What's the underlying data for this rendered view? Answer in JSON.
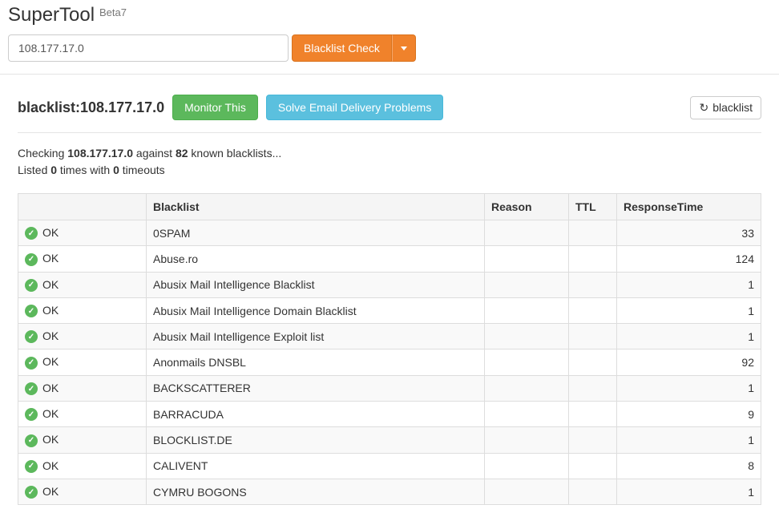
{
  "header": {
    "title": "SuperTool",
    "beta": "Beta7",
    "input_value": "108.177.17.0",
    "check_button": "Blacklist Check"
  },
  "result": {
    "title": "blacklist:108.177.17.0",
    "monitor_button": "Monitor This",
    "solve_button": "Solve Email Delivery Problems",
    "refresh_label": "blacklist",
    "checking_prefix": "Checking ",
    "checking_ip": "108.177.17.0",
    "checking_mid": " against ",
    "blacklist_count": "82",
    "checking_suffix": " known blacklists...",
    "listed_prefix": "Listed ",
    "listed_count": "0",
    "listed_mid": " times with ",
    "timeout_count": "0",
    "listed_suffix": " timeouts"
  },
  "table": {
    "headers": {
      "status": "",
      "blacklist": "Blacklist",
      "reason": "Reason",
      "ttl": "TTL",
      "response_time": "ResponseTime"
    },
    "rows": [
      {
        "status": "OK",
        "blacklist": "0SPAM",
        "reason": "",
        "ttl": "",
        "response_time": "33"
      },
      {
        "status": "OK",
        "blacklist": "Abuse.ro",
        "reason": "",
        "ttl": "",
        "response_time": "124"
      },
      {
        "status": "OK",
        "blacklist": "Abusix Mail Intelligence Blacklist",
        "reason": "",
        "ttl": "",
        "response_time": "1"
      },
      {
        "status": "OK",
        "blacklist": "Abusix Mail Intelligence Domain Blacklist",
        "reason": "",
        "ttl": "",
        "response_time": "1"
      },
      {
        "status": "OK",
        "blacklist": "Abusix Mail Intelligence Exploit list",
        "reason": "",
        "ttl": "",
        "response_time": "1"
      },
      {
        "status": "OK",
        "blacklist": "Anonmails DNSBL",
        "reason": "",
        "ttl": "",
        "response_time": "92"
      },
      {
        "status": "OK",
        "blacklist": "BACKSCATTERER",
        "reason": "",
        "ttl": "",
        "response_time": "1"
      },
      {
        "status": "OK",
        "blacklist": "BARRACUDA",
        "reason": "",
        "ttl": "",
        "response_time": "9"
      },
      {
        "status": "OK",
        "blacklist": "BLOCKLIST.DE",
        "reason": "",
        "ttl": "",
        "response_time": "1"
      },
      {
        "status": "OK",
        "blacklist": "CALIVENT",
        "reason": "",
        "ttl": "",
        "response_time": "8"
      },
      {
        "status": "OK",
        "blacklist": "CYMRU BOGONS",
        "reason": "",
        "ttl": "",
        "response_time": "1"
      }
    ]
  }
}
